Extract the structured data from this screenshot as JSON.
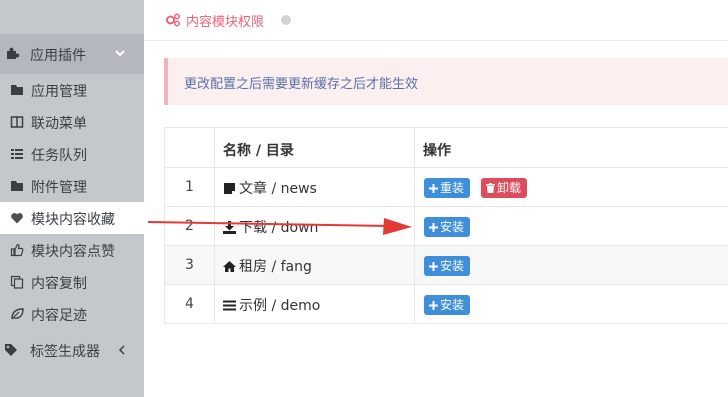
{
  "sidebar": {
    "group": {
      "label": "应用插件",
      "icon": "puzzle-icon",
      "chevron": "chevron-down-icon"
    },
    "items": [
      {
        "label": "应用管理",
        "icon": "folder-icon"
      },
      {
        "label": "联动菜单",
        "icon": "columns-icon"
      },
      {
        "label": "任务队列",
        "icon": "list-icon"
      },
      {
        "label": "附件管理",
        "icon": "folder-icon"
      },
      {
        "label": "模块内容收藏",
        "icon": "heart-icon",
        "active": true
      },
      {
        "label": "模块内容点赞",
        "icon": "thumbs-up-icon"
      },
      {
        "label": "内容复制",
        "icon": "copy-icon"
      },
      {
        "label": "内容足迹",
        "icon": "leaf-icon"
      }
    ],
    "tail": {
      "label": "标签生成器",
      "icon": "tag-icon",
      "chevron": "chevron-left-icon"
    }
  },
  "page": {
    "title": "内容模块权限",
    "title_icon": "cogs-icon",
    "alert": "更改配置之后需要更新缓存之后才能生效"
  },
  "table": {
    "headers": [
      "",
      "名称 / 目录",
      "操作"
    ],
    "rows": [
      {
        "num": "1",
        "name": "文章 / news",
        "icon": "file-icon",
        "actions": [
          {
            "label": "重装",
            "icon": "plus-icon",
            "color": "#3e8ed9"
          },
          {
            "label": "卸载",
            "icon": "trash-icon",
            "color": "#dc4c5c"
          }
        ]
      },
      {
        "num": "2",
        "name": "下载 / down",
        "icon": "download-icon",
        "actions": [
          {
            "label": "安装",
            "icon": "plus-icon",
            "color": "#3e8ed9"
          }
        ]
      },
      {
        "num": "3",
        "name": "租房 / fang",
        "icon": "home-icon",
        "actions": [
          {
            "label": "安装",
            "icon": "plus-icon",
            "color": "#3e8ed9"
          }
        ]
      },
      {
        "num": "4",
        "name": "示例 / demo",
        "icon": "bars-icon",
        "actions": [
          {
            "label": "安装",
            "icon": "plus-icon",
            "color": "#3e8ed9"
          }
        ]
      }
    ]
  },
  "colors": {
    "accent_pink": "#e8657a",
    "btn_blue": "#3e8ed9",
    "btn_red": "#dc4c5c",
    "annotation_red": "#e53935"
  }
}
